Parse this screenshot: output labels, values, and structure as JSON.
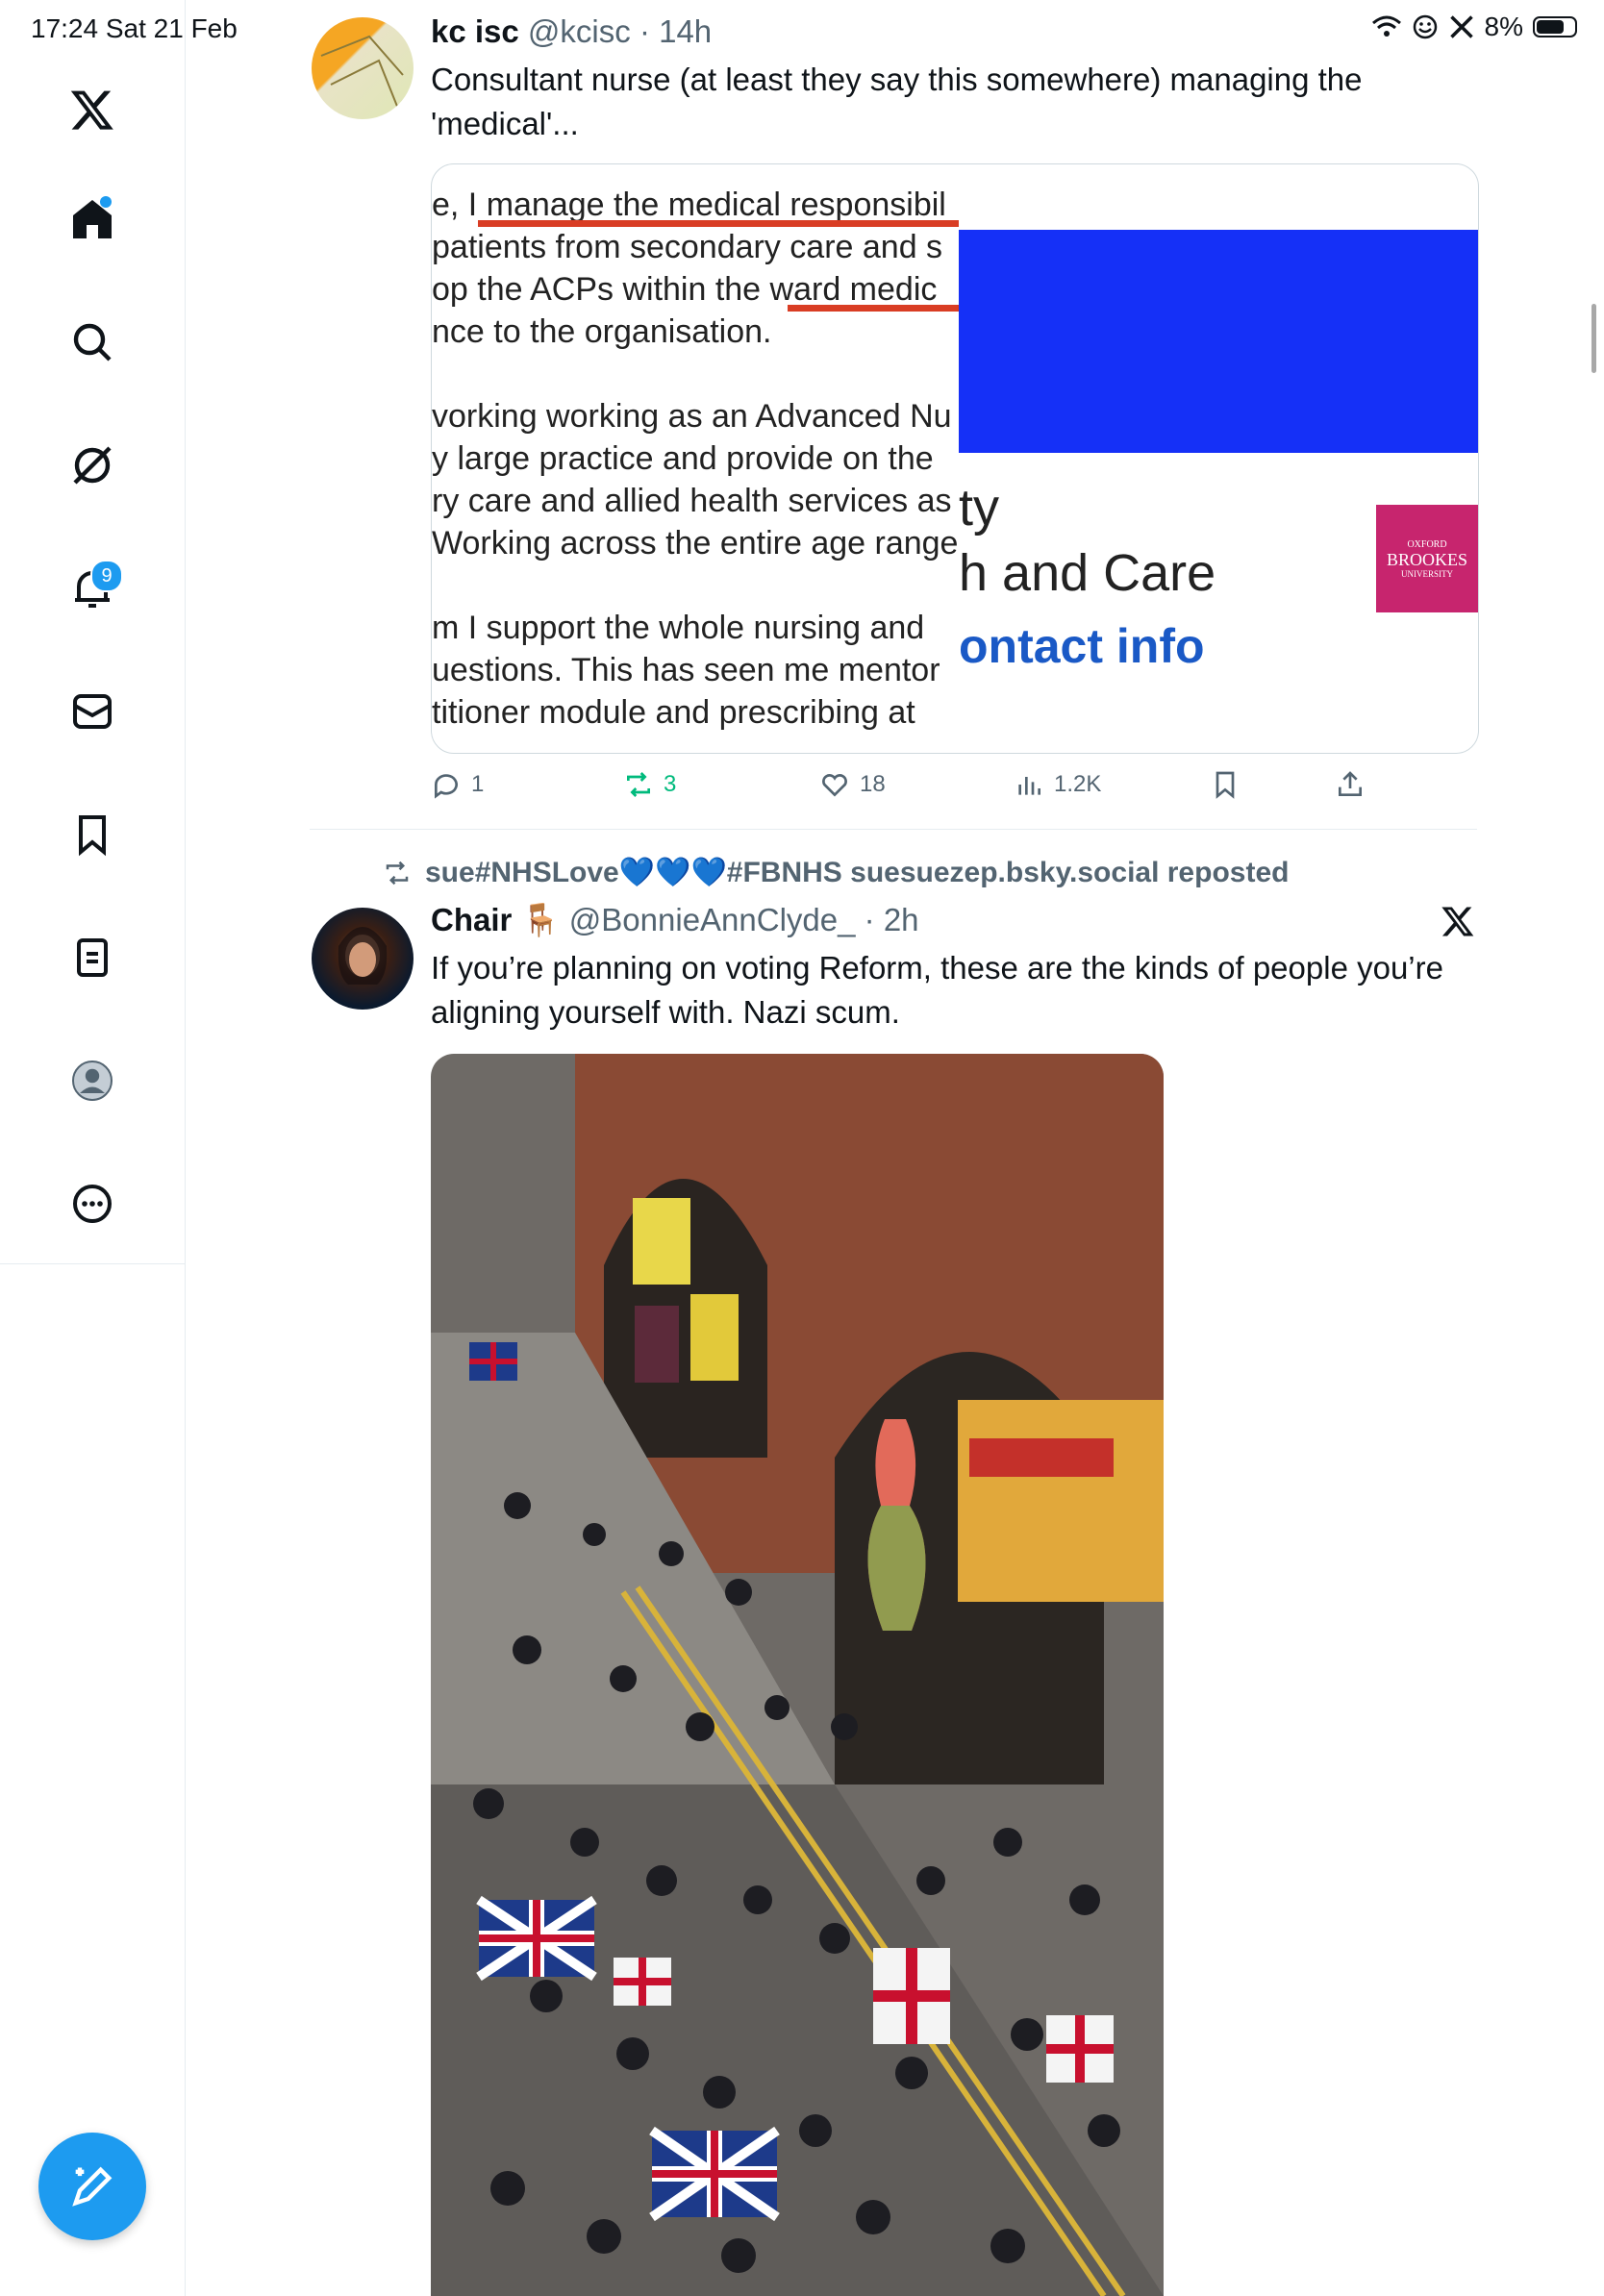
{
  "status_bar": {
    "time_date": "17:24  Sat 21 Feb",
    "battery": "8%"
  },
  "sidebar": {
    "notifications_badge": "9"
  },
  "tweet1": {
    "name": "kc isc",
    "handle": "@kcisc",
    "time": "· 14h",
    "text_line1": "Consultant nurse (at least they say this somewhere)  managing the",
    "text_line2": "'medical'...",
    "doc_lines": [
      "e, I manage the medical responsibil",
      "patients from secondary care and s",
      "op the ACPs within the ward medic",
      "nce to the organisation.",
      "",
      "vorking working as an Advanced Nu",
      "y large practice and provide on the",
      "ry care and allied health services as",
      "Working across the entire age range",
      "",
      "m I support the whole nursing and",
      "uestions. This has seen me mentor",
      "titioner module and prescribing at"
    ],
    "web_fragments": {
      "line1": "ty",
      "line2": "h and Care",
      "line3": "ontact info",
      "logo_top": "OXFORD",
      "logo_mid": "BROOKES",
      "logo_bot": "UNIVERSITY"
    },
    "stats": {
      "replies": "1",
      "reposts": "3",
      "likes": "18",
      "views": "1.2K"
    }
  },
  "tweet2": {
    "repost_label": "sue#NHSLove💙💙💙#FBNHS suesuezep.bsky.social reposted",
    "name": "Chair",
    "name_emoji": "🪑",
    "handle": "@BonnieAnnClyde_",
    "time": "· 2h",
    "text_line1": "If you’re planning on voting Reform, these are the kinds of people you’re",
    "text_line2": "aligning yourself with. Nazi scum."
  },
  "colors": {
    "accent": "#1d9bf0",
    "repost_green": "#00ba7c",
    "underline_red": "#d93d24",
    "card_blue": "#1530f7",
    "brookes_pink": "#c7256e"
  }
}
